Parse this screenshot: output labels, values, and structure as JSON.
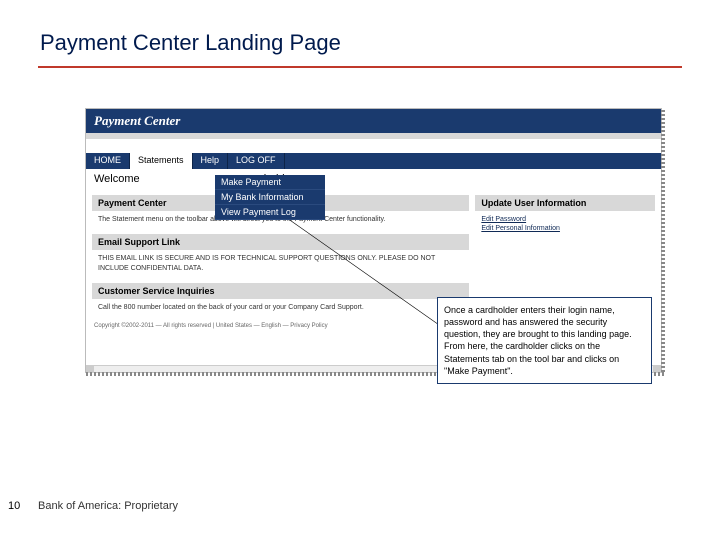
{
  "slide": {
    "title": "Payment Center Landing Page",
    "page_number": "10",
    "footer": "Bank of America: Proprietary"
  },
  "screenshot": {
    "brand": "Payment Center",
    "tabs": {
      "home": "HOME",
      "statements": "Statements",
      "help": "Help",
      "logoff": "LOG OFF"
    },
    "dropdown": {
      "make_payment": "Make Payment",
      "my_bank": "My Bank Information",
      "view_log": "View Payment Log"
    },
    "welcome_prefix": "Welcome",
    "welcome_suffix": "holder",
    "left_panels": {
      "pc_head": "Payment Center",
      "pc_body": "The Statement menu on the toolbar above will direct you to the Payment Center functionality.",
      "email_head": "Email Support Link",
      "email_body": "THIS EMAIL LINK IS SECURE AND IS FOR TECHNICAL SUPPORT QUESTIONS ONLY. PLEASE DO NOT INCLUDE CONFIDENTIAL DATA.",
      "csi_head": "Customer Service Inquiries",
      "csi_body": "Call the 800 number located on the back of your card or your Company Card Support."
    },
    "right_panel": {
      "head": "Update User Information",
      "link1": "Edit Password",
      "link2": "Edit Personal Information"
    },
    "copyright": "Copyright ©2002-2011 — All rights reserved | United States — English — Privacy Policy"
  },
  "callout": {
    "text": "Once a cardholder enters their login name, password and has answered the security question, they are brought to this landing page. From here, the cardholder clicks on the Statements tab on the tool bar and  clicks on \"Make Payment\"."
  }
}
